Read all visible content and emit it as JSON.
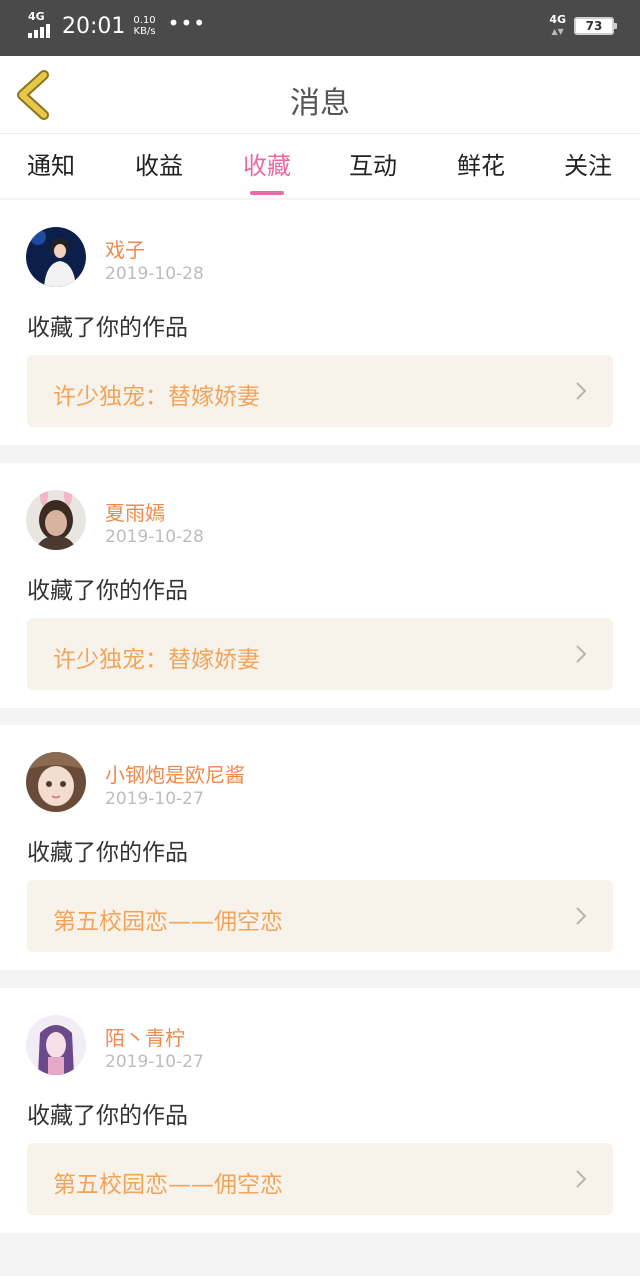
{
  "status_bar": {
    "network": "4G",
    "time": "20:01",
    "speed_value": "0.10",
    "speed_unit": "KB/s",
    "dots": "•••",
    "network_right": "4G",
    "battery": "73"
  },
  "header": {
    "title": "消息",
    "back_icon": "chevron-left-icon",
    "accent_color": "#e8c84a"
  },
  "tabs": [
    {
      "label": "通知",
      "active": false
    },
    {
      "label": "收益",
      "active": false
    },
    {
      "label": "收藏",
      "active": true
    },
    {
      "label": "互动",
      "active": false
    },
    {
      "label": "鲜花",
      "active": false
    },
    {
      "label": "关注",
      "active": false
    }
  ],
  "active_tab_color": "#e86aa5",
  "messages": [
    {
      "user": "戏子",
      "date": "2019-10-28",
      "action": "收藏了你的作品",
      "work": "许少独宠：替嫁娇妻"
    },
    {
      "user": "夏雨嫣",
      "date": "2019-10-28",
      "action": "收藏了你的作品",
      "work": "许少独宠：替嫁娇妻"
    },
    {
      "user": "小钢炮是欧尼酱",
      "date": "2019-10-27",
      "action": "收藏了你的作品",
      "work": "第五校园恋——佣空恋"
    },
    {
      "user": "陌丶青柠",
      "date": "2019-10-27",
      "action": "收藏了你的作品",
      "work": "第五校园恋——佣空恋"
    }
  ]
}
